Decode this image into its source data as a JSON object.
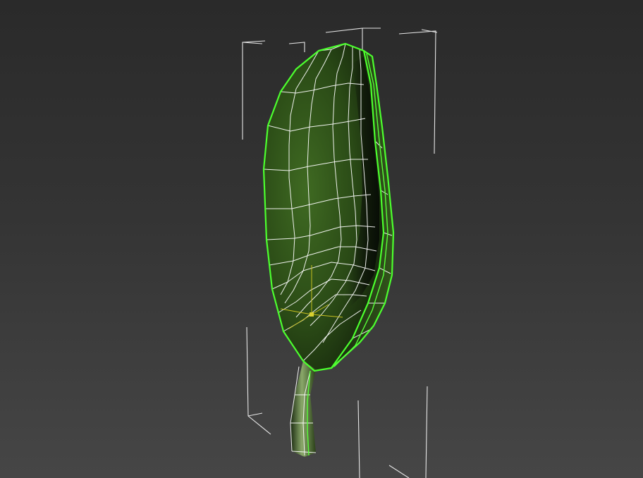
{
  "viewport": {
    "background_top": "#2a2a2a",
    "background_bottom": "#464646"
  },
  "object": {
    "kind": "leaf-mesh",
    "selected": true,
    "selection_outline_color": "#4cff2e",
    "wireframe_color": "#ffffff",
    "leaf_color_light": "#3f6a22",
    "leaf_color_dark": "#0d1608",
    "bounding_box_color": "#e6e6e6",
    "pivot_gizmo_color": "#c8c020"
  }
}
